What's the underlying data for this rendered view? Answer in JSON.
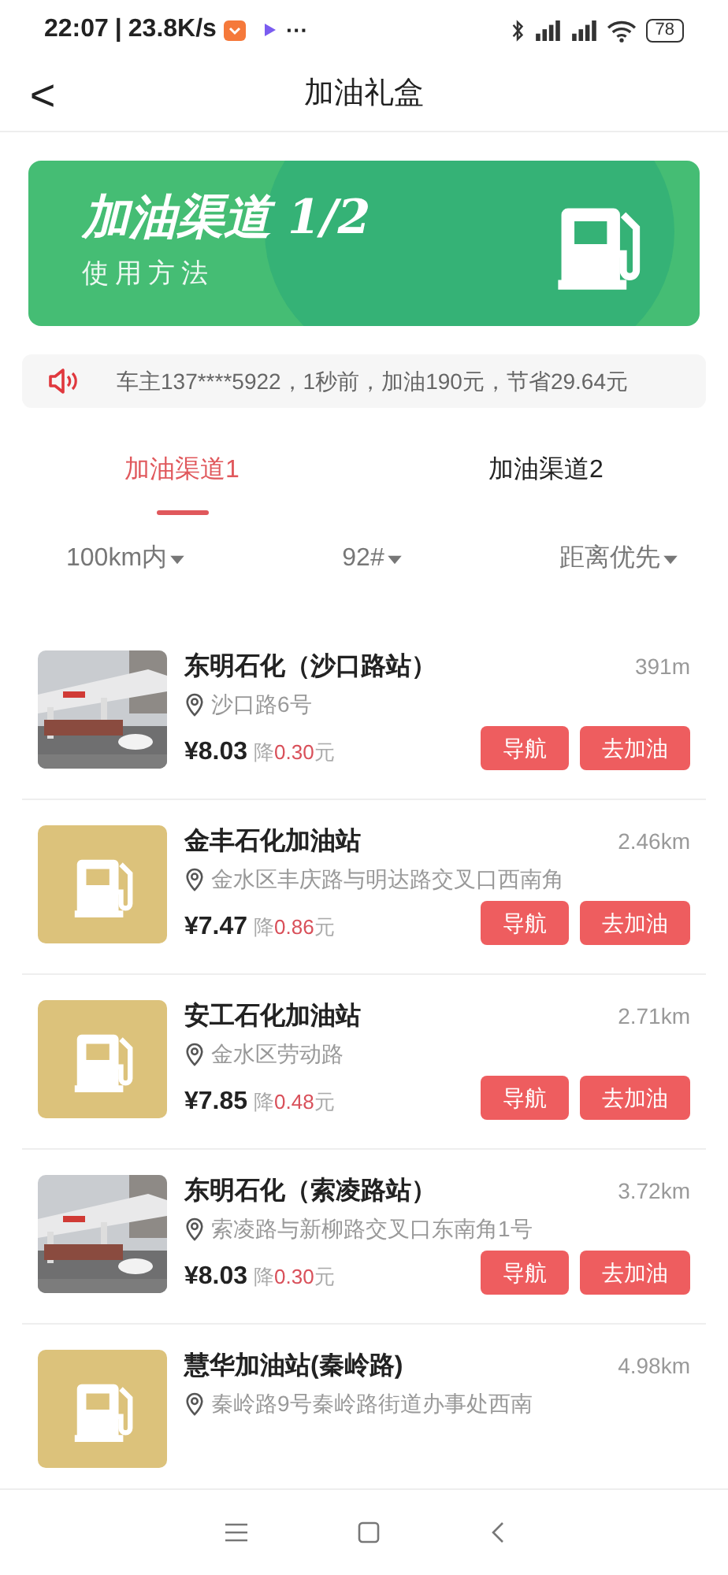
{
  "status_bar": {
    "time": "22:07",
    "separator": "|",
    "speed": "23.8K/s",
    "more": "···",
    "battery": "78"
  },
  "header": {
    "back": "<",
    "title": "加油礼盒"
  },
  "banner": {
    "title": "加油渠道 1/2",
    "subtitle": "使用方法"
  },
  "notice": {
    "text": "车主137****5922，1秒前，加油190元，节省29.64元"
  },
  "tabs": [
    {
      "label": "加油渠道1",
      "selected": true
    },
    {
      "label": "加油渠道2",
      "selected": false
    }
  ],
  "filters": [
    {
      "label": "100km内"
    },
    {
      "label": "92#"
    },
    {
      "label": "距离优先"
    }
  ],
  "stations": [
    {
      "name": "东明石化（沙口路站）",
      "address": "沙口路6号",
      "distance": "391m",
      "price": "¥8.03",
      "discount_prefix": "降",
      "discount": "0.30",
      "discount_unit": "元",
      "buttons": [
        "导航",
        "去加油"
      ]
    },
    {
      "kind": "pump",
      "name": "金丰石化加油站",
      "address": "金水区丰庆路与明达路交叉口西南角",
      "distance": "2.46km",
      "price": "¥7.47",
      "discount_prefix": "降",
      "discount": "0.86",
      "discount_unit": "元",
      "buttons": [
        "导航",
        "去加油"
      ]
    },
    {
      "kind": "pump",
      "name": "安工石化加油站",
      "address": "金水区劳动路",
      "distance": "2.71km",
      "price": "¥7.85",
      "discount_prefix": "降",
      "discount": "0.48",
      "discount_unit": "元",
      "buttons": [
        "导航",
        "去加油"
      ]
    },
    {
      "name": "东明石化（索凌路站）",
      "address": "索凌路与新柳路交叉口东南角1号",
      "distance": "3.72km",
      "price": "¥8.03",
      "discount_prefix": "降",
      "discount": "0.30",
      "discount_unit": "元",
      "buttons": [
        "导航",
        "去加油"
      ]
    },
    {
      "kind": "pump",
      "name": "慧华加油站(秦岭路)",
      "address": "秦岭路9号秦岭路街道办事处西南",
      "distance": "4.98km"
    }
  ]
}
